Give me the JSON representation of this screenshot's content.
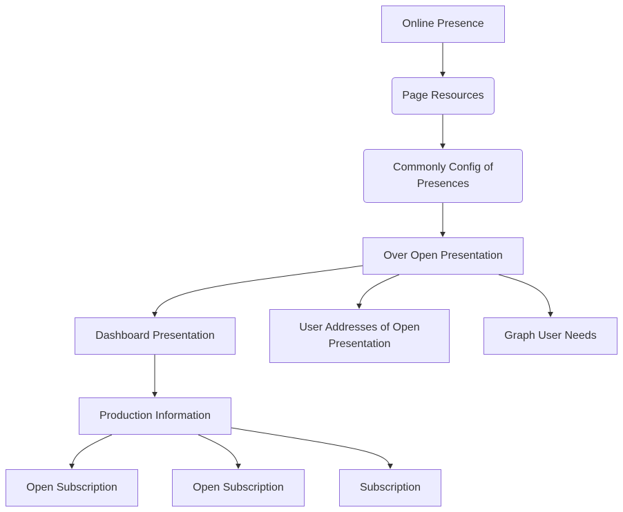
{
  "diagram": {
    "type": "flowchart",
    "direction": "top-down",
    "colors": {
      "node_fill": "#ececff",
      "node_border": "#9370db",
      "edge": "#333333",
      "text": "#333333"
    },
    "nodes": [
      {
        "id": "online_presence",
        "label": "Online Presence",
        "shape": "rect"
      },
      {
        "id": "page_resources",
        "label": "Page Resources",
        "shape": "rounded"
      },
      {
        "id": "commonly_config",
        "label": "Commonly Config of Presences",
        "shape": "rounded"
      },
      {
        "id": "over_open",
        "label": "Over Open Presentation",
        "shape": "rect"
      },
      {
        "id": "dashboard",
        "label": "Dashboard Presentation",
        "shape": "rect"
      },
      {
        "id": "user_addresses",
        "label": "User Addresses of Open Presentation",
        "shape": "rect"
      },
      {
        "id": "graph_user",
        "label": "Graph User Needs",
        "shape": "rect"
      },
      {
        "id": "production_info",
        "label": "Production Information",
        "shape": "rect"
      },
      {
        "id": "open_sub_1",
        "label": "Open Subscription",
        "shape": "rect"
      },
      {
        "id": "open_sub_2",
        "label": "Open Subscription",
        "shape": "rect"
      },
      {
        "id": "subscription",
        "label": "Subscription",
        "shape": "rect"
      }
    ],
    "edges": [
      {
        "from": "online_presence",
        "to": "page_resources"
      },
      {
        "from": "page_resources",
        "to": "commonly_config"
      },
      {
        "from": "commonly_config",
        "to": "over_open"
      },
      {
        "from": "over_open",
        "to": "dashboard"
      },
      {
        "from": "over_open",
        "to": "user_addresses"
      },
      {
        "from": "over_open",
        "to": "graph_user"
      },
      {
        "from": "dashboard",
        "to": "production_info"
      },
      {
        "from": "production_info",
        "to": "open_sub_1"
      },
      {
        "from": "production_info",
        "to": "open_sub_2"
      },
      {
        "from": "production_info",
        "to": "subscription"
      }
    ]
  }
}
